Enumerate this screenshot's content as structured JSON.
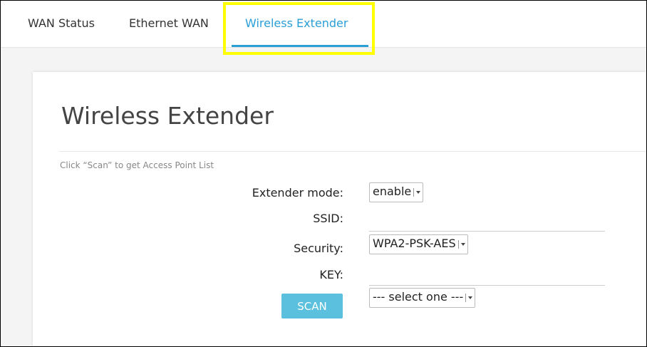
{
  "tabs": [
    {
      "label": "WAN Status",
      "active": false
    },
    {
      "label": "Ethernet WAN",
      "active": false
    },
    {
      "label": "Wireless Extender",
      "active": true
    }
  ],
  "colors": {
    "accent": "#2a9fd6",
    "highlight": "#ffff00",
    "button": "#5bc0de"
  },
  "page": {
    "title": "Wireless Extender",
    "hint": "Click “Scan” to get Access Point List"
  },
  "form": {
    "extender_mode": {
      "label": "Extender mode:",
      "value": "enable"
    },
    "ssid": {
      "label": "SSID:",
      "value": ""
    },
    "security": {
      "label": "Security:",
      "value": "WPA2-PSK-AES"
    },
    "key": {
      "label": "KEY:",
      "value": ""
    },
    "scan_label": "SCAN",
    "ap_select": {
      "value": "--- select one ---"
    }
  }
}
